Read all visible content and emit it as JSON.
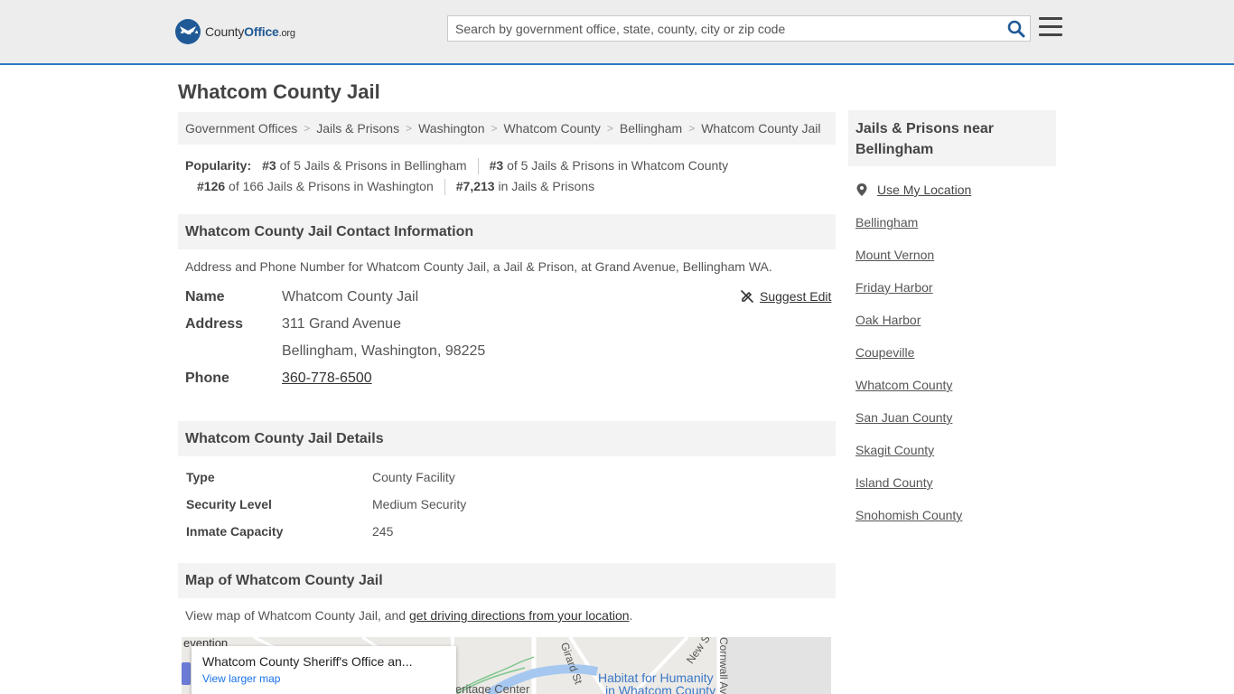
{
  "header": {
    "logo_main": "County",
    "logo_accent": "Office",
    "logo_suffix": ".org",
    "search_placeholder": "Search by government office, state, county, city or zip code"
  },
  "page": {
    "title": "Whatcom County Jail"
  },
  "breadcrumb": [
    "Government Offices",
    "Jails & Prisons",
    "Washington",
    "Whatcom County",
    "Bellingham",
    "Whatcom County Jail"
  ],
  "popularity": {
    "label": "Popularity:",
    "items": [
      {
        "rank": "#3",
        "text": "of 5 Jails & Prisons in Bellingham"
      },
      {
        "rank": "#3",
        "text": "of 5 Jails & Prisons in Whatcom County"
      },
      {
        "rank": "#126",
        "text": "of 166 Jails & Prisons in Washington"
      },
      {
        "rank": "#7,213",
        "text": "in Jails & Prisons"
      }
    ]
  },
  "contact": {
    "heading": "Whatcom County Jail Contact Information",
    "description": "Address and Phone Number for Whatcom County Jail, a Jail & Prison, at Grand Avenue, Bellingham WA.",
    "name_label": "Name",
    "name_value": "Whatcom County Jail",
    "address_label": "Address",
    "address_line1": "311 Grand Avenue",
    "address_line2": "Bellingham, Washington, 98225",
    "phone_label": "Phone",
    "phone_value": "360-778-6500",
    "suggest_edit": "Suggest Edit"
  },
  "details": {
    "heading": "Whatcom County Jail Details",
    "rows": [
      {
        "label": "Type",
        "value": "County Facility"
      },
      {
        "label": "Security Level",
        "value": "Medium Security"
      },
      {
        "label": "Inmate Capacity",
        "value": "245"
      }
    ]
  },
  "map": {
    "heading": "Map of Whatcom County Jail",
    "desc_prefix": "View map of Whatcom County Jail, and ",
    "desc_link": "get driving directions from your location",
    "desc_suffix": ".",
    "card_title": "Whatcom County Sheriff's Office an...",
    "card_link": "View larger map",
    "label_detention": "evention",
    "label_heritage": "leritage Center",
    "label_girard": "Girard St",
    "label_new": "New St",
    "label_cornwall": "Cornwall Ave",
    "poi_line1": "Habitat for Humanity",
    "poi_line2": "in Whatcom County"
  },
  "sidebar": {
    "heading": "Jails & Prisons near Bellingham",
    "use_location": "Use My Location",
    "links": [
      "Bellingham",
      "Mount Vernon",
      "Friday Harbor",
      "Oak Harbor",
      "Coupeville",
      "Whatcom County",
      "San Juan County",
      "Skagit County",
      "Island County",
      "Snohomish County"
    ]
  },
  "colors": {
    "accent": "#2a7ac0",
    "logo_blue": "#1f5a96",
    "header_bg": "#ededed",
    "panel_bg": "#f3f3f3"
  }
}
